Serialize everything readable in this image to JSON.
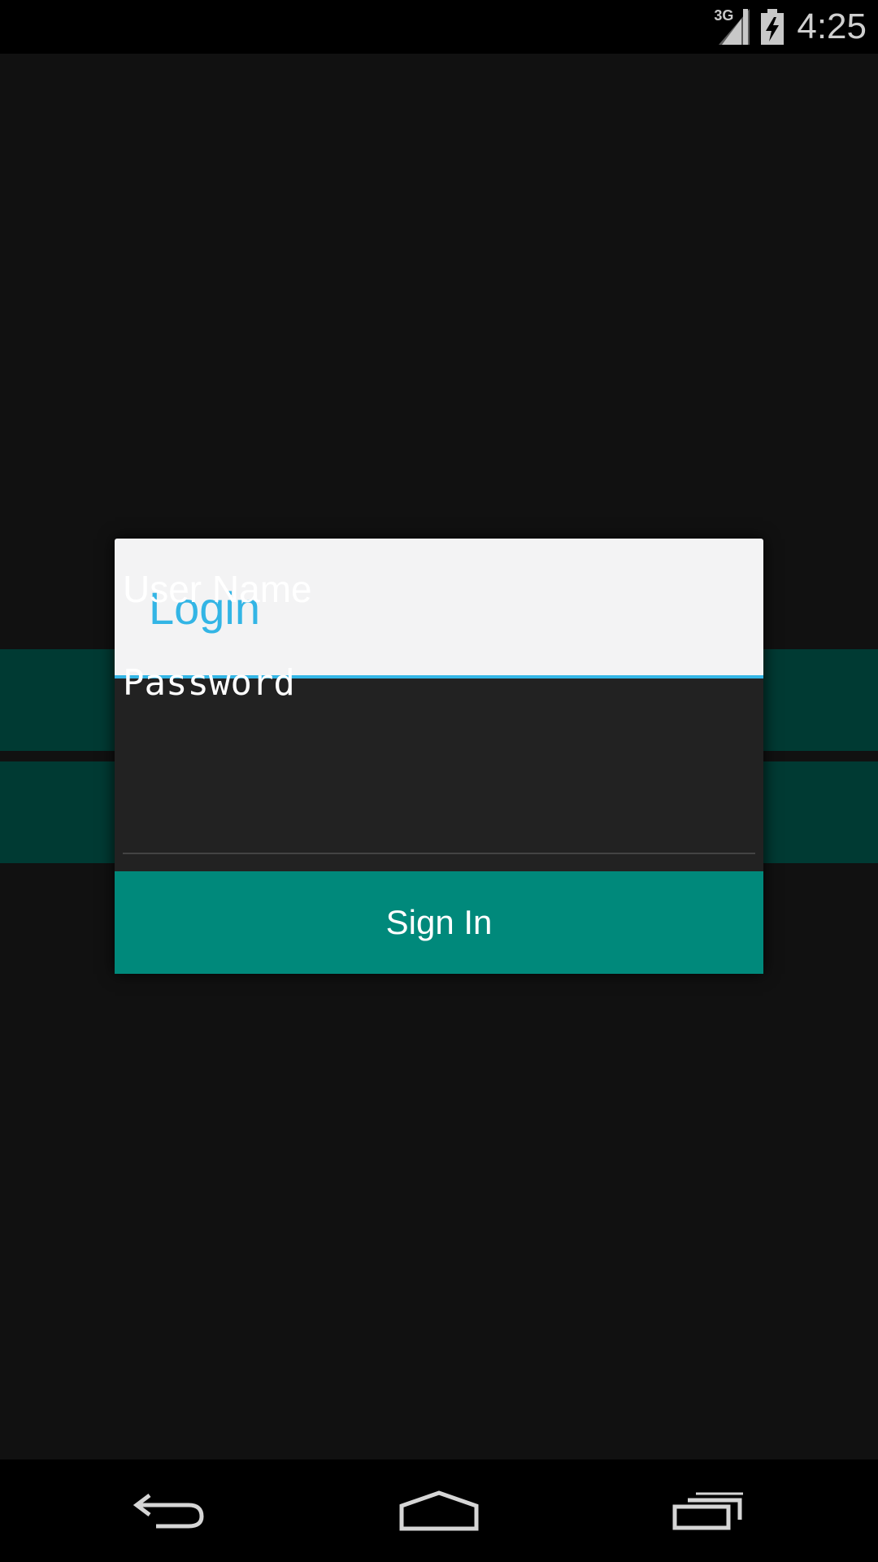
{
  "status_bar": {
    "network": "3G",
    "time": "4:25",
    "icons": [
      "signal-icon",
      "battery-charging-icon"
    ]
  },
  "dialog": {
    "title": "Login",
    "username_placeholder": "User Name",
    "password_placeholder": "Password",
    "sign_in_label": "Sign In"
  },
  "nav_bar": {
    "icons": [
      "back-icon",
      "home-icon",
      "recents-icon"
    ]
  },
  "colors": {
    "background": "#111111",
    "accent_blue": "#33b5e5",
    "button_teal": "#00897b",
    "stripe_teal": "#003a33",
    "dialog_header": "#f3f3f4",
    "dialog_body": "#222222"
  }
}
